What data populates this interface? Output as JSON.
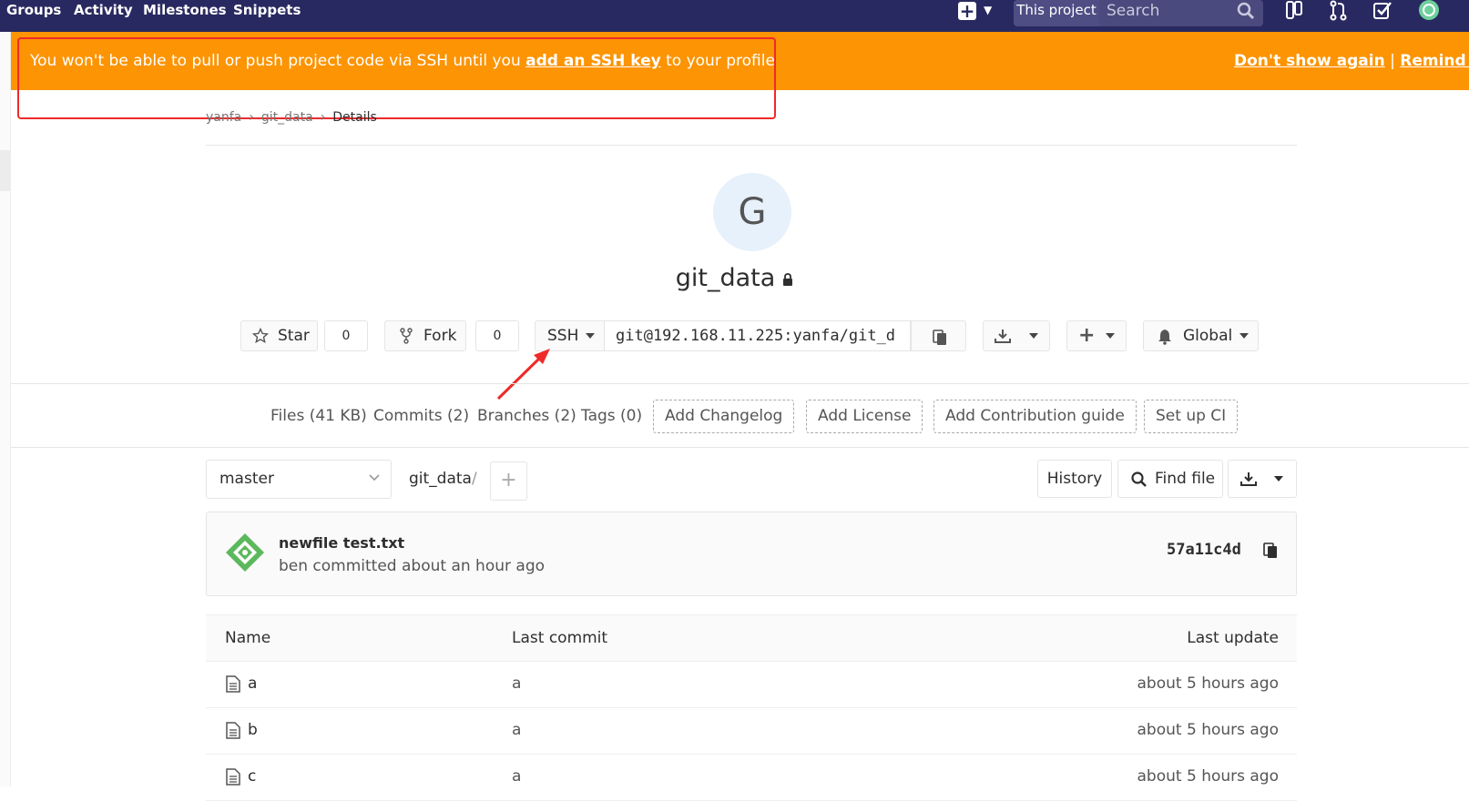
{
  "nav": {
    "links": [
      "Groups",
      "Activity",
      "Milestones",
      "Snippets"
    ],
    "scope": "This project",
    "search_placeholder": "Search"
  },
  "alert": {
    "text_before": "You won't be able to pull or push project code via SSH until you ",
    "link": "add an SSH key",
    "text_after": " to your profile",
    "dont_show": "Don't show again",
    "separator": " | ",
    "remind": "Remind later"
  },
  "breadcrumb": [
    "yanfa",
    "git_data",
    "Details"
  ],
  "project": {
    "initial": "G",
    "name": "git_data"
  },
  "actions": {
    "star_label": "Star",
    "star_count": "0",
    "fork_label": "Fork",
    "fork_count": "0",
    "protocol": "SSH",
    "clone_url": "git@192.168.11.225:yanfa/git_d",
    "notification": "Global"
  },
  "stats": {
    "files": "Files (41 KB)",
    "commits": "Commits (2)",
    "branches": "Branches (2)",
    "tags": "Tags (0)",
    "add_changelog": "Add Changelog",
    "add_license": "Add License",
    "add_contribution": "Add Contribution guide",
    "setup_ci": "Set up CI"
  },
  "tree": {
    "branch": "master",
    "path": "git_data",
    "path_sep": "/",
    "history": "History",
    "find_file": "Find file"
  },
  "commit": {
    "title": "newfile test.txt",
    "meta": "ben committed about an hour ago",
    "sha": "57a11c4d"
  },
  "table": {
    "headers": [
      "Name",
      "Last commit",
      "Last update"
    ],
    "rows": [
      {
        "name": "a",
        "commit": "a",
        "update": "about 5 hours ago"
      },
      {
        "name": "b",
        "commit": "a",
        "update": "about 5 hours ago"
      },
      {
        "name": "c",
        "commit": "a",
        "update": "about 5 hours ago"
      }
    ]
  },
  "colors": {
    "nav_bg": "#292961",
    "alert_bg": "#fc9403",
    "annotation_red": "#ee2a2a"
  }
}
